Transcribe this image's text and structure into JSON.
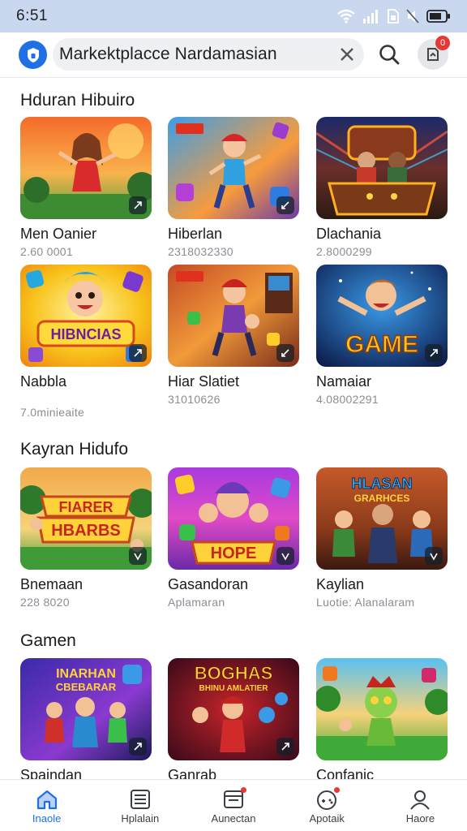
{
  "status_bar": {
    "time": "6:51",
    "icons": [
      "wifi-icon",
      "signal-icon",
      "sim-icon",
      "mute-icon",
      "battery-icon"
    ]
  },
  "search": {
    "value": "Markektplacce  Nardamasian",
    "icons": [
      "shield-icon",
      "clear-icon",
      "search-icon",
      "notification-icon"
    ],
    "notification_count": "0"
  },
  "sections": [
    {
      "title": "Hduran Hibuiro",
      "cards": [
        {
          "title": "Men Oanier",
          "subtitle": "2.60 0001",
          "icon": "share-icon"
        },
        {
          "title": "Hiberlan",
          "subtitle": "2318032330",
          "icon": "expand-icon"
        },
        {
          "title": "Dlachania",
          "subtitle": "2.8000299",
          "icon": ""
        }
      ]
    },
    {
      "title": "",
      "cards": [
        {
          "title": "Nabbla",
          "subtitle": "7.0minieaite",
          "icon": "share-icon"
        },
        {
          "title": "Hiar Slatiet",
          "subtitle": "31010626",
          "icon": "expand-icon"
        },
        {
          "title": "Namaiar",
          "subtitle": "4.08002291",
          "icon": "share-icon"
        }
      ]
    },
    {
      "title": "Kayran Hidufo",
      "cards": [
        {
          "title": "Bnemaan",
          "subtitle": "228 8020",
          "icon": "check-icon"
        },
        {
          "title": "Gasandoran",
          "subtitle": "Aplamaran",
          "icon": "check-icon"
        },
        {
          "title": "Kaylian",
          "subtitle": "Luotie: Alanalaram",
          "icon": "check-icon"
        }
      ]
    },
    {
      "title": "Gamen",
      "cards": [
        {
          "title": "Spaindan",
          "subtitle": "",
          "icon": "share-icon"
        },
        {
          "title": "Ganrab",
          "subtitle": "",
          "icon": "share-icon"
        },
        {
          "title": "Confanic",
          "subtitle": "",
          "icon": ""
        }
      ]
    }
  ],
  "bottom_nav": [
    {
      "label": "Inaole",
      "icon": "home-icon",
      "active": true
    },
    {
      "label": "Hplalain",
      "icon": "list-icon",
      "active": false
    },
    {
      "label": "Aunectan",
      "icon": "calendar-icon",
      "active": false
    },
    {
      "label": "Apotaik",
      "icon": "gamepad-icon",
      "active": false
    },
    {
      "label": "Haore",
      "icon": "profile-icon",
      "active": false
    }
  ],
  "colors": {
    "accent": "#1f6fe5",
    "status_bar": "#c9d8ef",
    "badge": "#e53935"
  }
}
